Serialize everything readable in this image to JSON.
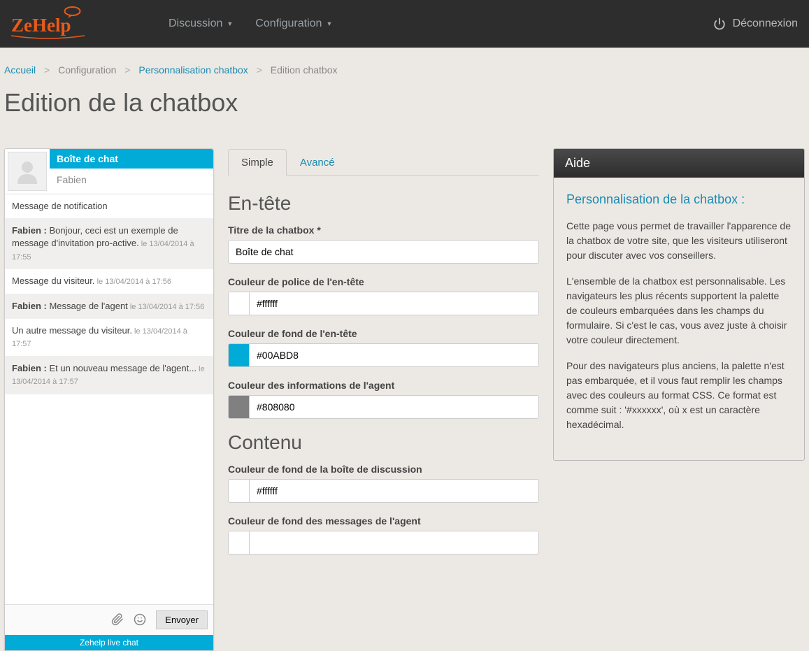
{
  "nav": {
    "menu": [
      "Discussion",
      "Configuration"
    ],
    "logout": "Déconnexion"
  },
  "breadcrumb": {
    "home": "Accueil",
    "config": "Configuration",
    "personalization": "Personnalisation chatbox",
    "current": "Edition chatbox"
  },
  "page_title": "Edition de la chatbox",
  "preview": {
    "title": "Boîte de chat",
    "agent_name": "Fabien",
    "notification": "Message de notification",
    "messages": [
      {
        "agent": true,
        "who": "Fabien :",
        "text": " Bonjour, ceci est un exemple de message d'invitation pro-active.",
        "ts": " le 13/04/2014 à 17:55"
      },
      {
        "agent": false,
        "who": "",
        "text": "Message du visiteur.",
        "ts": " le 13/04/2014 à 17:56"
      },
      {
        "agent": true,
        "who": "Fabien :",
        "text": " Message de l'agent",
        "ts": " le 13/04/2014 à 17:56"
      },
      {
        "agent": false,
        "who": "",
        "text": "Un autre message du visiteur.",
        "ts": " le 13/04/2014 à 17:57"
      },
      {
        "agent": true,
        "who": "Fabien :",
        "text": " Et un nouveau message de l'agent...",
        "ts": " le 13/04/2014 à 17:57"
      }
    ],
    "send": "Envoyer",
    "footer": "Zehelp live chat"
  },
  "tabs": {
    "simple": "Simple",
    "advanced": "Avancé"
  },
  "form": {
    "header_section": "En-tête",
    "title_label": "Titre de la chatbox *",
    "title_value": "Boîte de chat",
    "header_font_color_label": "Couleur de police de l'en-tête",
    "header_font_color_value": "#ffffff",
    "header_bg_color_label": "Couleur de fond de l'en-tête",
    "header_bg_color_value": "#00ABD8",
    "header_bg_color_swatch": "#00ABD8",
    "agent_info_color_label": "Couleur des informations de l'agent",
    "agent_info_color_value": "#808080",
    "agent_info_color_swatch": "#808080",
    "content_section": "Contenu",
    "chatbox_bg_label": "Couleur de fond de la boîte de discussion",
    "chatbox_bg_value": "#ffffff",
    "agent_msg_bg_label": "Couleur de fond des messages de l'agent"
  },
  "help": {
    "title": "Aide",
    "heading": "Personnalisation de la chatbox :",
    "p1": "Cette page vous permet de travailler l'apparence de la chatbox de votre site, que les visiteurs utiliseront pour discuter avec vos conseillers.",
    "p2": "L'ensemble de la chatbox est personnalisable. Les navigateurs les plus récents supportent la palette de couleurs embarquées dans les champs du formulaire. Si c'est le cas, vous avez juste à choisir votre couleur directement.",
    "p3": "Pour des navigateurs plus anciens, la palette n'est pas embarquée, et il vous faut remplir les champs avec des couleurs au format CSS. Ce format est comme suit : '#xxxxxx', où x est un caractère hexadécimal."
  }
}
